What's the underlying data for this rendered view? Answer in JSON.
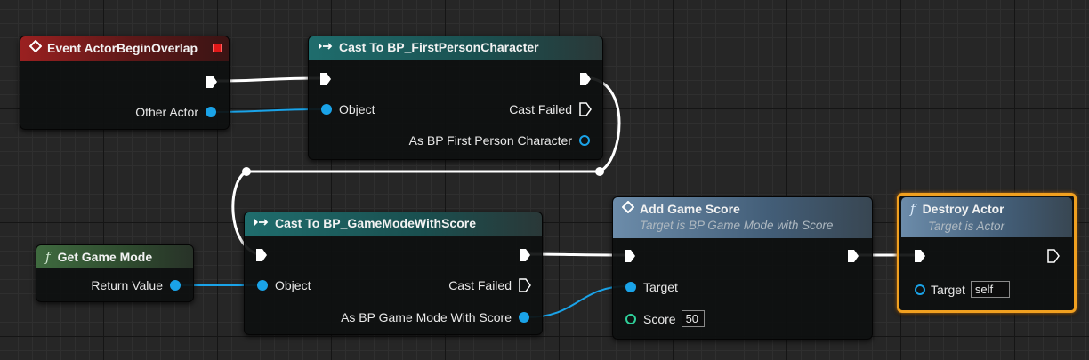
{
  "colors": {
    "exec_wire": "#ffffff",
    "data_wire_object": "#1aa3e8",
    "event_header": "#9a2020",
    "cast_header": "#1f6d6d",
    "pure_header": "#3f6a3f",
    "function_header": "#6c8caa",
    "selection": "#f0a020"
  },
  "nodes": {
    "event_overlap": {
      "title": "Event ActorBeginOverlap",
      "icon": "event-diamond-icon",
      "pins": {
        "other_actor": "Other Actor"
      }
    },
    "cast_fpc": {
      "title": "Cast To BP_FirstPersonCharacter",
      "icon": "cast-arrows-icon",
      "pins": {
        "object": "Object",
        "cast_failed": "Cast Failed",
        "as_result": "As BP First Person Character"
      }
    },
    "get_game_mode": {
      "title": "Get Game Mode",
      "icon": "function-f-icon",
      "pins": {
        "return_value": "Return Value"
      }
    },
    "cast_gamemode": {
      "title": "Cast To BP_GameModeWithScore",
      "icon": "cast-arrows-icon",
      "pins": {
        "object": "Object",
        "cast_failed": "Cast Failed",
        "as_result": "As BP Game Mode With Score"
      }
    },
    "add_game_score": {
      "title": "Add Game Score",
      "subtitle": "Target is BP Game Mode with Score",
      "icon": "event-diamond-icon",
      "pins": {
        "target": "Target",
        "score": "Score",
        "score_value": "50"
      }
    },
    "destroy_actor": {
      "title": "Destroy Actor",
      "subtitle": "Target is Actor",
      "icon": "function-f-icon",
      "selected": true,
      "pins": {
        "target": "Target",
        "target_value": "self"
      }
    }
  }
}
